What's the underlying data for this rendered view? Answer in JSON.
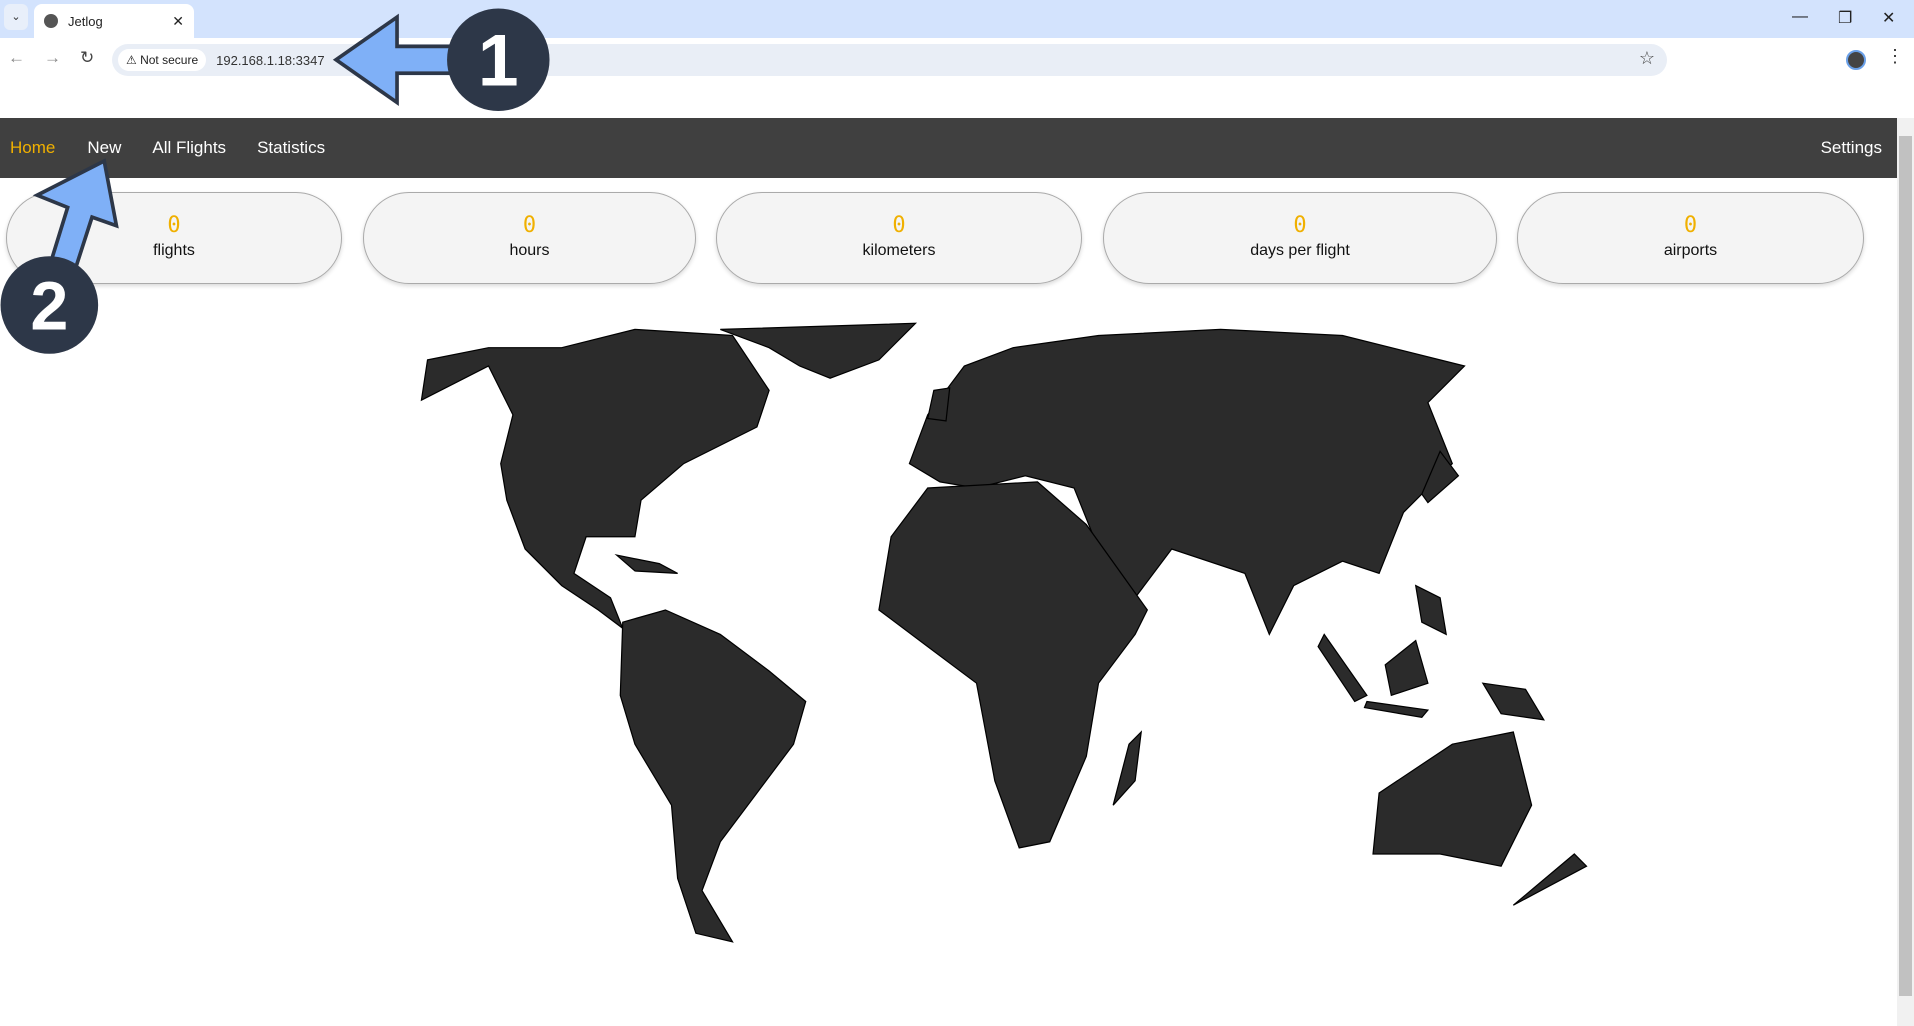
{
  "browser": {
    "tab_title": "Jetlog",
    "security_label": "Not secure",
    "url": "192.168.1.18:3347"
  },
  "nav": {
    "items": [
      {
        "label": "Home",
        "active": true
      },
      {
        "label": "New"
      },
      {
        "label": "All Flights"
      },
      {
        "label": "Statistics"
      }
    ],
    "settings": "Settings",
    "active_color": "#f0b000"
  },
  "stats": [
    {
      "value": "0",
      "label": "flights"
    },
    {
      "value": "0",
      "label": "hours"
    },
    {
      "value": "0",
      "label": "kilometers"
    },
    {
      "value": "0",
      "label": "days per flight"
    },
    {
      "value": "0",
      "label": "airports"
    }
  ],
  "annotations": {
    "step1": "1",
    "step2": "2"
  }
}
